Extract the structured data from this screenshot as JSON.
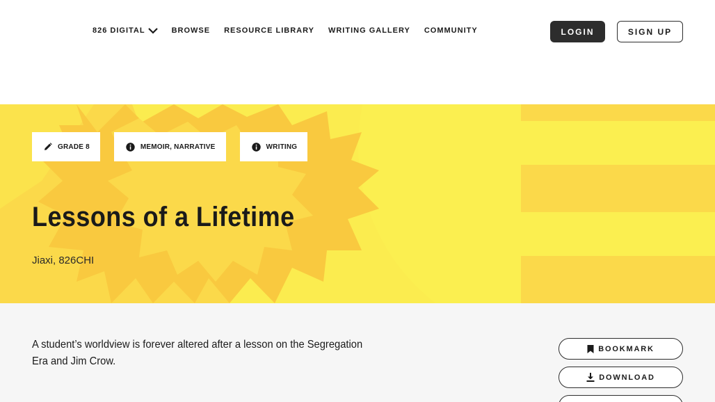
{
  "nav": {
    "items": [
      {
        "label": "826 DIGITAL",
        "has_dropdown": true
      },
      {
        "label": "BROWSE"
      },
      {
        "label": "RESOURCE LIBRARY"
      },
      {
        "label": "WRITING GALLERY"
      },
      {
        "label": "COMMUNITY"
      }
    ],
    "login_label": "LOGIN",
    "signup_label": "SIGN UP"
  },
  "hero": {
    "tags": [
      {
        "label": "GRADE 8",
        "icon": "pencil-icon"
      },
      {
        "label": "MEMOIR, NARRATIVE",
        "icon": "info-icon"
      },
      {
        "label": "WRITING",
        "icon": "info-icon"
      }
    ],
    "title": "Lessons of a Lifetime",
    "author": "Jiaxi, 826CHI",
    "colors": {
      "background": "#fbd94a",
      "accent": "#f9c93f",
      "light": "#fbef50"
    }
  },
  "content": {
    "summary": "A student’s worldview is forever altered after a lesson on the Segregation Era and Jim Crow.",
    "actions": [
      {
        "label": "BOOKMARK",
        "icon": "bookmark-icon"
      },
      {
        "label": "DOWNLOAD",
        "icon": "download-icon"
      }
    ]
  }
}
